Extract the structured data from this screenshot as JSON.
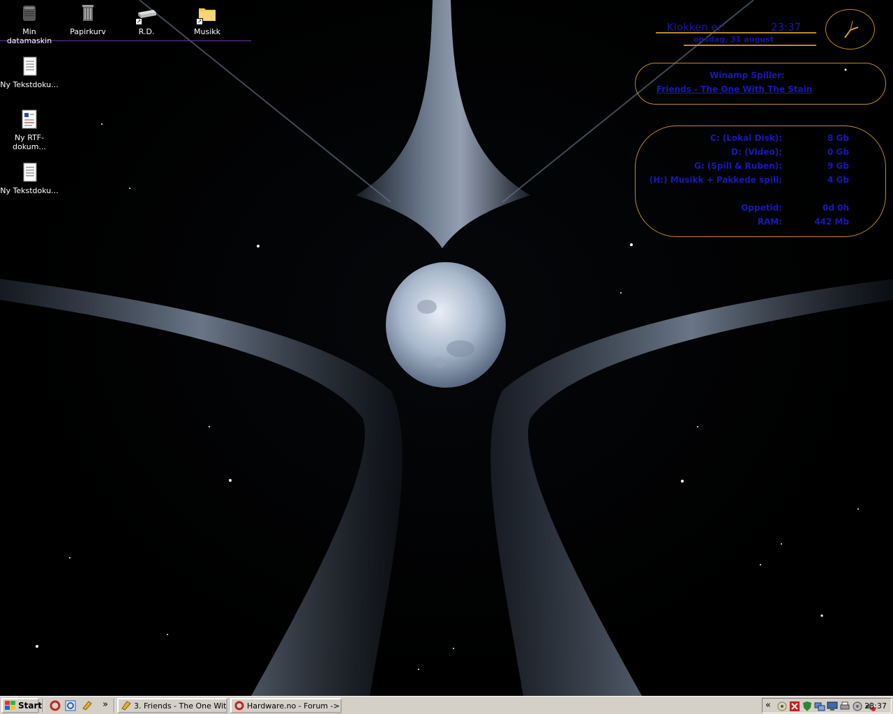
{
  "desktop": {
    "icons": [
      {
        "label": "Min datamaskin",
        "icon": "computer-icon"
      },
      {
        "label": "Papirkurv",
        "icon": "recycle-bin-icon"
      },
      {
        "label": "R.D.",
        "icon": "drive-shortcut-icon"
      },
      {
        "label": "Musikk",
        "icon": "folder-shortcut-icon"
      },
      {
        "label": "Ny Tekstdoku...",
        "icon": "text-document-icon"
      },
      {
        "label": "Ny RTF-dokum...",
        "icon": "rtf-document-icon"
      },
      {
        "label": "Ny Tekstdoku...",
        "icon": "text-document-icon"
      }
    ]
  },
  "clock_widget": {
    "title": "Klokken er:",
    "time": "23:37",
    "date": "onsdag, 31 august"
  },
  "winamp_widget": {
    "title": "Winamp Spiller:",
    "track": "Friends - The One With The Stain"
  },
  "system_widget": {
    "rows": [
      {
        "label": "C: (Lokal Disk):",
        "value": "8 Gb"
      },
      {
        "label": "D: (Video):",
        "value": "0 Gb"
      },
      {
        "label": "G: (Spill & Ruben):",
        "value": "9 Gb"
      },
      {
        "label": "(H:) Musikk + Pakkede spill:",
        "value": "4 Gb"
      },
      {
        "label": "Oppetid:",
        "value": "0d 0h"
      },
      {
        "label": "RAM:",
        "value": "442 Mb"
      }
    ]
  },
  "taskbar": {
    "start_label": "Start",
    "more_label": "»",
    "tasks": [
      {
        "label": "3. Friends - The One Wit...",
        "icon": "winamp-icon"
      },
      {
        "label": "Hardware.no - Forum ->...",
        "icon": "opera-icon"
      }
    ],
    "tray_expand": "«",
    "clock": "23:37"
  },
  "colors": {
    "widget_text": "#1818b8",
    "widget_border": "#c08a2a",
    "taskbar_bg": "#d4d0c8"
  }
}
